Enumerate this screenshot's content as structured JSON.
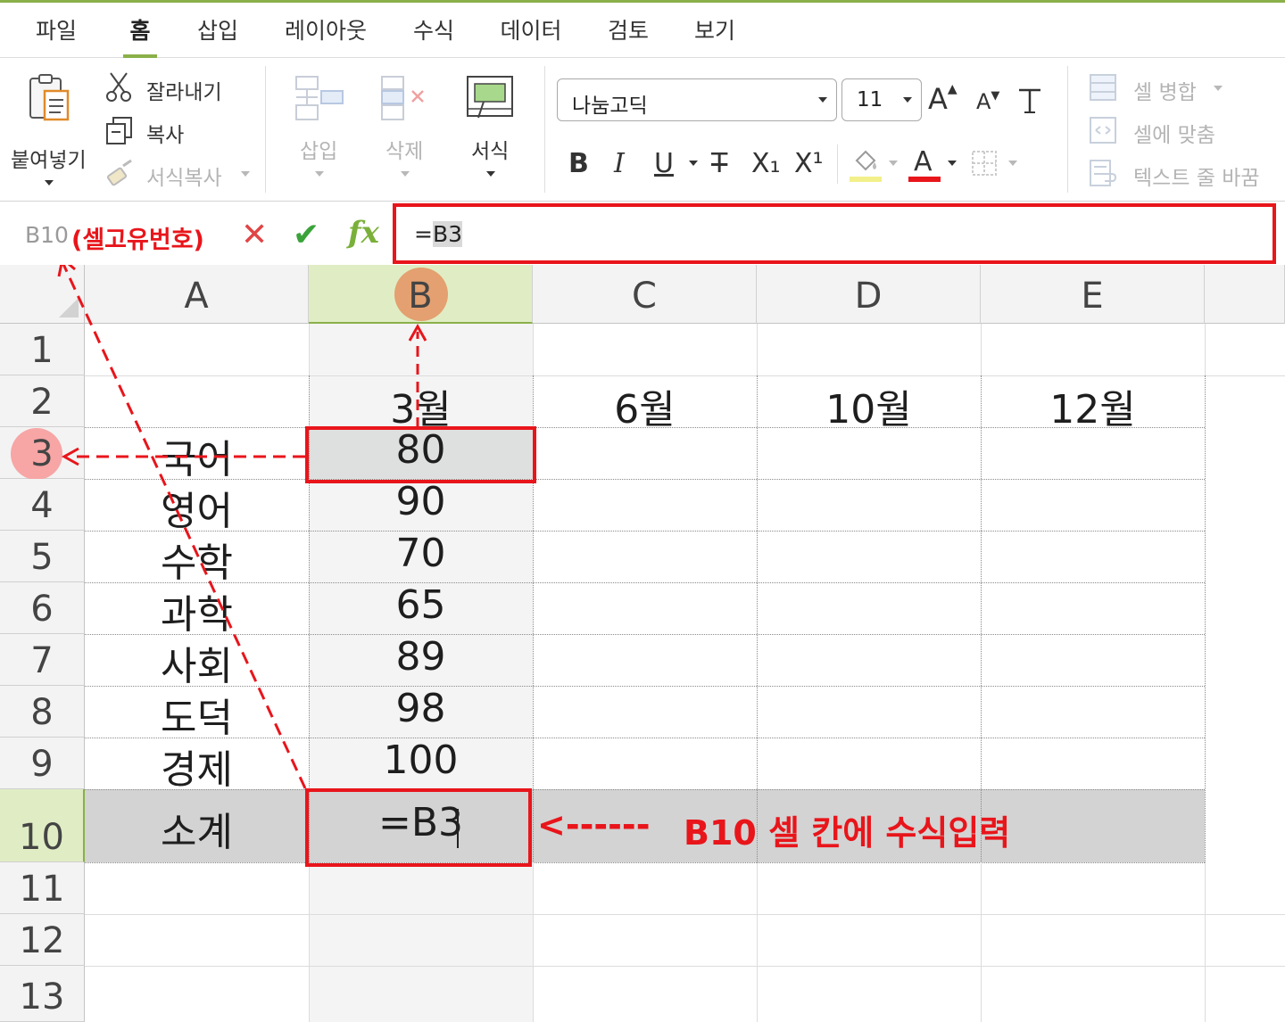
{
  "menu": {
    "tabs": [
      {
        "label": "파일"
      },
      {
        "label": "홈"
      },
      {
        "label": "삽입"
      },
      {
        "label": "레이아웃"
      },
      {
        "label": "수식"
      },
      {
        "label": "데이터"
      },
      {
        "label": "검토"
      },
      {
        "label": "보기"
      }
    ],
    "active_tab": "홈"
  },
  "ribbon": {
    "paste": "붙여넣기",
    "cut": "잘라내기",
    "copy": "복사",
    "format_painter": "서식복사",
    "insert": "삽입",
    "delete": "삭제",
    "format": "서식",
    "font_name": "나눔고딕",
    "font_size": "11",
    "bold": "B",
    "italic": "I",
    "underline": "U",
    "strike": "T",
    "subscript": "X₁",
    "superscript": "X¹",
    "font_color_letter": "A",
    "merge_cells": "셀 병합",
    "fit_to_cell": "셀에 맞춤",
    "wrap_text": "텍스트 줄 바꿈",
    "highlight_color": "#f2f08a",
    "font_color": "#e8151b"
  },
  "formula_bar": {
    "name_box": "B10",
    "name_note": "(셀고유번호)",
    "fx": "fx",
    "formula_prefix": "=",
    "formula_ref": "B3"
  },
  "grid": {
    "columns": [
      "A",
      "B",
      "C",
      "D",
      "E"
    ],
    "rows": [
      "1",
      "2",
      "3",
      "4",
      "5",
      "6",
      "7",
      "8",
      "9",
      "10",
      "11",
      "12",
      "13"
    ],
    "selected_column": "B",
    "selected_row": "10",
    "header_row": [
      "",
      "3월",
      "6월",
      "10월",
      "12월"
    ],
    "subjects": [
      "국어",
      "영어",
      "수학",
      "과학",
      "사회",
      "도덕",
      "경제",
      "소계"
    ],
    "scores": [
      "80",
      "90",
      "70",
      "65",
      "89",
      "98",
      "100",
      "=B3"
    ]
  },
  "annotation": {
    "arrow_text": "<------",
    "text": "B10 셀 칸에 수식입력"
  },
  "colors": {
    "accent_green": "#8ab04a",
    "annotation_red": "#e8151b",
    "selection_fill": "#e0edc4",
    "b3_fill": "#dde0de",
    "row10_fill": "#d3d3d3"
  }
}
